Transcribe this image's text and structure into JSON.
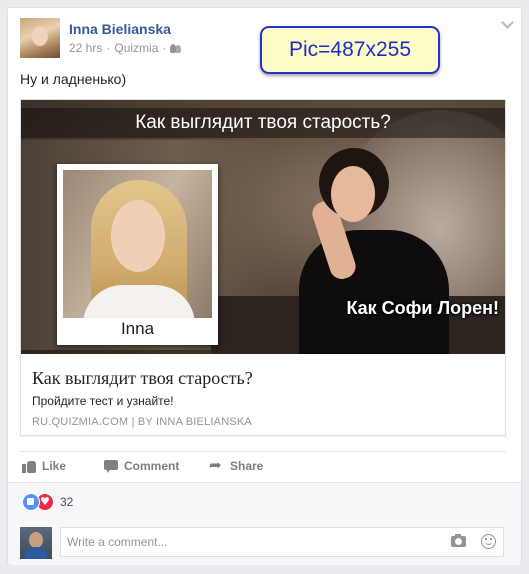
{
  "post": {
    "author": "Inna Bielianska",
    "time": "22 hrs",
    "app": "Quizmia",
    "separator": "·",
    "privacy_icon": "friends-icon",
    "text": "Ну и ладненько)"
  },
  "overlay_tag": "Pic=487x255",
  "link": {
    "image_title": "Как выглядит твоя старость?",
    "polaroid_name": "Inna",
    "image_caption": "Как Софи Лорен!",
    "title": "Как выглядит твоя старость?",
    "description": "Пройдите тест и узнайте!",
    "domain": "RU.QUIZMIA.COM",
    "divider": "|",
    "byline": "BY INNA BIELIANSKA"
  },
  "actions": {
    "like": "Like",
    "comment": "Comment",
    "share": "Share"
  },
  "reactions": {
    "count": "32",
    "types": [
      "like",
      "love"
    ],
    "colors": {
      "like": "#5890ff",
      "love": "#f0284a"
    }
  },
  "comment_box": {
    "placeholder": "Write a comment...",
    "icons": [
      "camera-icon",
      "emoji-icon"
    ]
  },
  "colors": {
    "author_link": "#365899",
    "meta_text": "#90949c",
    "action_text": "#7f7f7f",
    "overlay_border": "#2233c8",
    "overlay_bg": "#fdfcc8"
  }
}
